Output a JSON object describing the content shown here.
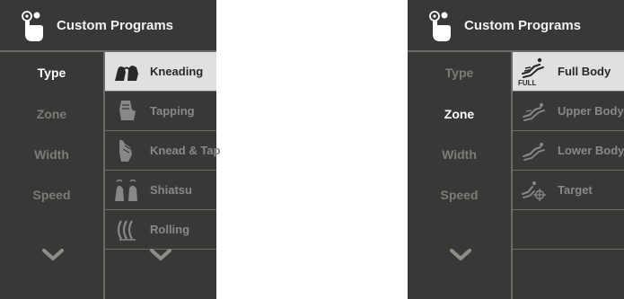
{
  "colors": {
    "panel_bg": "#3a3836",
    "divider": "#6d6b68",
    "selected_bg": "#e0e0e0",
    "active_text": "#ffffff",
    "inactive_text": "#7d7b78"
  },
  "left_panel": {
    "title": "Custom Programs",
    "header_icon": "hand-pointer-icon",
    "categories": [
      {
        "label": "Type",
        "active": true
      },
      {
        "label": "Zone",
        "active": false
      },
      {
        "label": "Width",
        "active": false
      },
      {
        "label": "Speed",
        "active": false
      }
    ],
    "options": [
      {
        "label": "Kneading",
        "icon": "kneading-hands-icon",
        "selected": true
      },
      {
        "label": "Tapping",
        "icon": "tapping-hand-icon",
        "selected": false
      },
      {
        "label": "Knead & Tap",
        "icon": "knead-tap-hand-icon",
        "selected": false
      },
      {
        "label": "Shiatsu",
        "icon": "shiatsu-thumbs-icon",
        "selected": false
      },
      {
        "label": "Rolling",
        "icon": "rolling-icon",
        "selected": false
      }
    ]
  },
  "right_panel": {
    "title": "Custom Programs",
    "header_icon": "hand-pointer-icon",
    "categories": [
      {
        "label": "Type",
        "active": false
      },
      {
        "label": "Zone",
        "active": true
      },
      {
        "label": "Width",
        "active": false
      },
      {
        "label": "Speed",
        "active": false
      }
    ],
    "options": [
      {
        "label": "Full Body",
        "icon": "full-body-chair-icon",
        "badge": "FULL",
        "selected": true
      },
      {
        "label": "Upper Body",
        "icon": "upper-body-chair-icon",
        "selected": false
      },
      {
        "label": "Lower Body",
        "icon": "lower-body-chair-icon",
        "selected": false
      },
      {
        "label": "Target",
        "icon": "target-chair-icon",
        "selected": false
      },
      {
        "label": "",
        "icon": "",
        "selected": false
      }
    ]
  }
}
